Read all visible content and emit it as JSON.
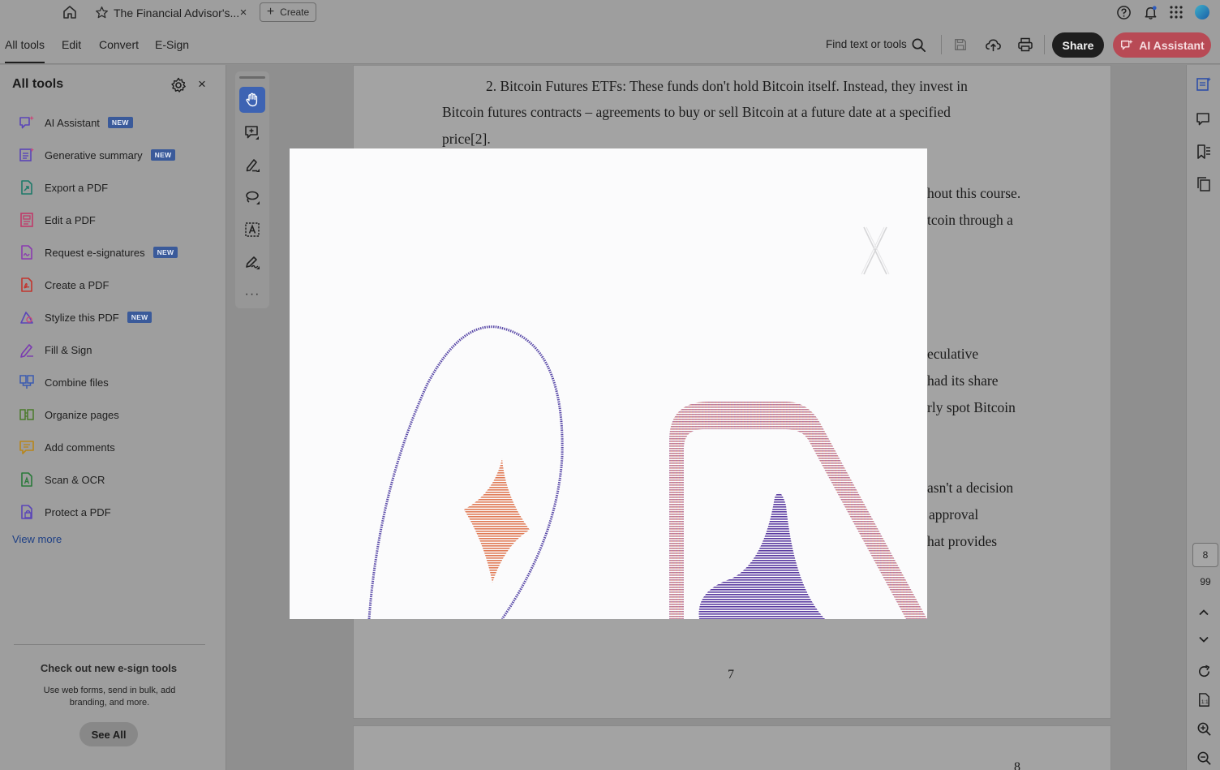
{
  "tabbar": {
    "tab_title": "The Financial Advisor's...",
    "tab_close": "×",
    "create_label": "Create"
  },
  "menubar": {
    "items": [
      "All tools",
      "Edit",
      "Convert",
      "E-Sign"
    ],
    "active": "All tools",
    "find_label": "Find text or tools",
    "share_label": "Share",
    "ai_label": "AI Assistant"
  },
  "left_panel": {
    "title": "All tools",
    "close": "×",
    "tools": [
      {
        "label": "AI Assistant",
        "badge": "NEW",
        "icon": "ai-assistant-icon"
      },
      {
        "label": "Generative summary",
        "badge": "NEW",
        "icon": "generative-summary-icon"
      },
      {
        "label": "Export a PDF",
        "badge": "",
        "icon": "export-pdf-icon"
      },
      {
        "label": "Edit a PDF",
        "badge": "",
        "icon": "edit-pdf-icon"
      },
      {
        "label": "Request e-signatures",
        "badge": "NEW",
        "icon": "request-signatures-icon"
      },
      {
        "label": "Create a PDF",
        "badge": "",
        "icon": "create-pdf-icon"
      },
      {
        "label": "Stylize this PDF",
        "badge": "NEW",
        "icon": "stylize-pdf-icon"
      },
      {
        "label": "Fill & Sign",
        "badge": "",
        "icon": "fill-sign-icon"
      },
      {
        "label": "Combine files",
        "badge": "",
        "icon": "combine-files-icon"
      },
      {
        "label": "Organize pages",
        "badge": "",
        "icon": "organize-pages-icon"
      },
      {
        "label": "Add comments",
        "badge": "",
        "icon": "add-comments-icon"
      },
      {
        "label": "Scan & OCR",
        "badge": "",
        "icon": "scan-ocr-icon"
      },
      {
        "label": "Protect a PDF",
        "badge": "",
        "icon": "protect-pdf-icon"
      }
    ],
    "view_more": "View more",
    "promo": {
      "title": "Check out new e-sign tools",
      "text": "Use web forms, send in bulk, add branding, and more.",
      "button": "See All"
    }
  },
  "quick_toolbar": {
    "tools": [
      "hand-icon",
      "add-comment-icon",
      "highlight-pen-icon",
      "lasso-icon",
      "text-select-icon",
      "sign-pen-icon"
    ],
    "more": "···"
  },
  "document": {
    "lines": [
      "2. Bitcoin Futures ETFs: These funds don't hold Bitcoin itself. Instead, they invest in",
      "Bitcoin futures contracts – agreements to buy or sell Bitcoin at a future date at a specified",
      "price[2].",
      "hout this course.",
      "tcoin through a",
      "eculative",
      "had its share",
      "rly spot Bitcoin",
      "asn't a decision",
      "approval",
      "hat provides"
    ],
    "page_number": "7",
    "next_page_number": "8"
  },
  "right_rail": {
    "current_page": "8",
    "total_pages": "99"
  },
  "colors": {
    "share_bg": "#1e1e1e",
    "ai_bg": "#b84a55",
    "badge_bg": "#3a5a9a",
    "active_tool": "#3d63b3",
    "modal_art_purple": "#5a3aa0",
    "modal_art_orange": "#e07a55"
  }
}
